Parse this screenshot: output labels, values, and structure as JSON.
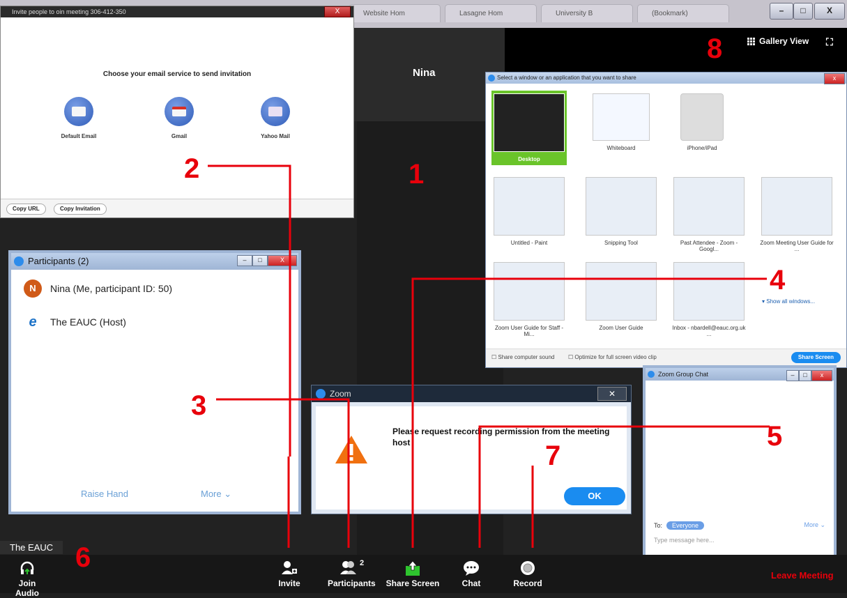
{
  "browser_tabs": [
    "Website Hom",
    "Lasagne Hom",
    "University B",
    "(Bookmark)"
  ],
  "main": {
    "participant_name": "Nina",
    "gallery_view_label": "Gallery View",
    "self_label": "The EAUC"
  },
  "toolbar": {
    "join_audio": "Join Audio",
    "invite": "Invite",
    "participants": "Participants",
    "participants_count": "2",
    "share_screen": "Share Screen",
    "chat": "Chat",
    "record": "Record",
    "leave_meeting": "Leave Meeting"
  },
  "invite_window": {
    "title": "Invite people to oin meeting 306-412-350",
    "heading": "Choose your email service to send invitation",
    "services": [
      "Default Email",
      "Gmail",
      "Yahoo Mail"
    ],
    "copy_url": "Copy URL",
    "copy_invitation": "Copy Invitation"
  },
  "participants_window": {
    "title": "Participants (2)",
    "users": [
      {
        "initial": "N",
        "name": "Nina (Me, participant ID: 50)"
      },
      {
        "initial": "e",
        "name": "The EAUC (Host)"
      }
    ],
    "raise_hand": "Raise Hand",
    "more": "More ⌄"
  },
  "share_window": {
    "title": "Select a window or an application that you want to share",
    "items": [
      "Desktop",
      "Whiteboard",
      "iPhone/iPad",
      "Untitled - Paint",
      "Snipping Tool",
      "Past Attendee - Zoom - Googl...",
      "Zoom Meeting User Guide for ...",
      "Zoom User Guide for Staff - Mi...",
      "Zoom User Guide",
      "Inbox - nbardell@eauc.org.uk ..."
    ],
    "show_all": "Show all windows...",
    "share_sound": "Share computer sound",
    "optimize": "Optimize for full screen video clip",
    "share_button": "Share Screen"
  },
  "chat_window": {
    "title": "Zoom Group Chat",
    "to_label": "To:",
    "recipient": "Everyone",
    "more": "More ⌄",
    "placeholder": "Type message here..."
  },
  "dialog": {
    "title": "Zoom",
    "message": "Please request recording permission from the meeting host",
    "ok": "OK"
  },
  "annotations": [
    "1",
    "2",
    "3",
    "4",
    "5",
    "6",
    "7",
    "8"
  ],
  "colors": {
    "annotation_red": "#e8000b",
    "share_green": "#2ec52e",
    "zoom_blue": "#1a8cf0",
    "leave_red": "#e8000b"
  }
}
